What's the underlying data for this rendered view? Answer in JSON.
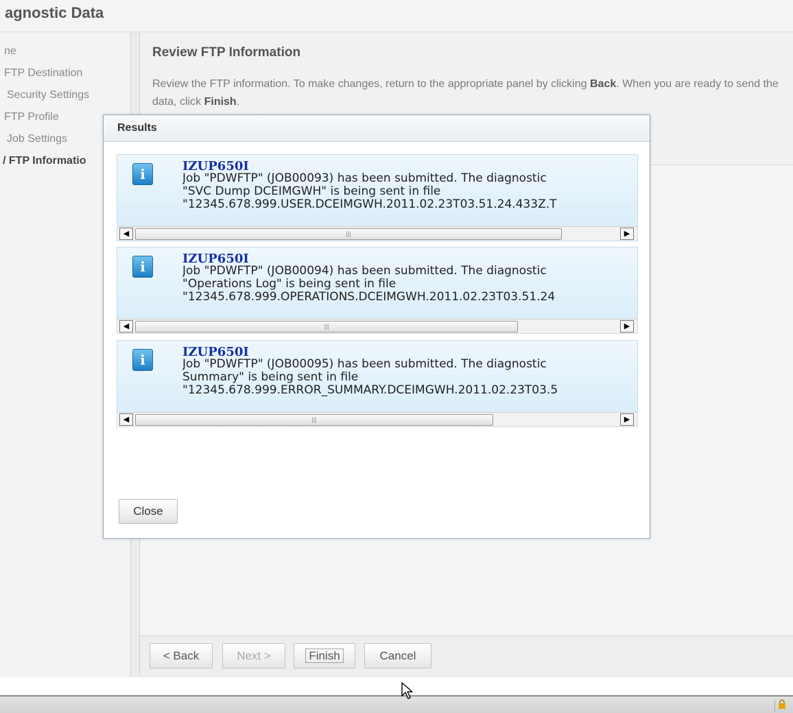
{
  "header": {
    "title": "agnostic Data"
  },
  "nav": {
    "items": [
      {
        "label": "ne"
      },
      {
        "label": "FTP Destination"
      },
      {
        "label": "Security Settings"
      },
      {
        "label": "FTP Profile"
      },
      {
        "label": "Job Settings"
      },
      {
        "label": "/ FTP Informatio"
      }
    ]
  },
  "panel": {
    "title": "Review FTP Information",
    "desc_part1": "Review the FTP information. To make changes, return to the appropriate panel by clicking ",
    "desc_back": "Back",
    "desc_part2": ". When you are ready to send the data, click ",
    "desc_finish": "Finish",
    "desc_end": "."
  },
  "wizard_buttons": {
    "back": "< Back",
    "next": "Next >",
    "finish": "Finish",
    "cancel": "Cancel"
  },
  "dialog": {
    "title": "Results",
    "close_label": "Close",
    "messages": [
      {
        "id": "IZUP650I",
        "line1": "Job \"PDWFTP\" (JOB00093) has been submitted. The diagnostic",
        "line2": "\"SVC Dump DCEIMGWH\" is being sent in file",
        "line3": "\"12345.678.999.USER.DCEIMGWH.2011.02.23T03.51.24.433Z.T"
      },
      {
        "id": "IZUP650I",
        "line1": "Job \"PDWFTP\" (JOB00094) has been submitted. The diagnostic",
        "line2": "\"Operations Log\" is being sent in file",
        "line3": "\"12345.678.999.OPERATIONS.DCEIMGWH.2011.02.23T03.51.24"
      },
      {
        "id": "IZUP650I",
        "line1": "Job \"PDWFTP\" (JOB00095) has been submitted. The diagnostic",
        "line2": "Summary\" is being sent in file",
        "line3": "\"12345.678.999.ERROR_SUMMARY.DCEIMGWH.2011.02.23T03.5"
      }
    ]
  },
  "icons": {
    "info": "information-icon",
    "scroll_left": "scroll-left-arrow-icon",
    "scroll_right": "scroll-right-arrow-icon",
    "lock": "lock-icon",
    "cursor": "mouse-pointer-icon"
  },
  "colors": {
    "message_id": "#1530a8",
    "info_icon": "#1c7fc4",
    "message_bg": "#d7ecf8"
  }
}
